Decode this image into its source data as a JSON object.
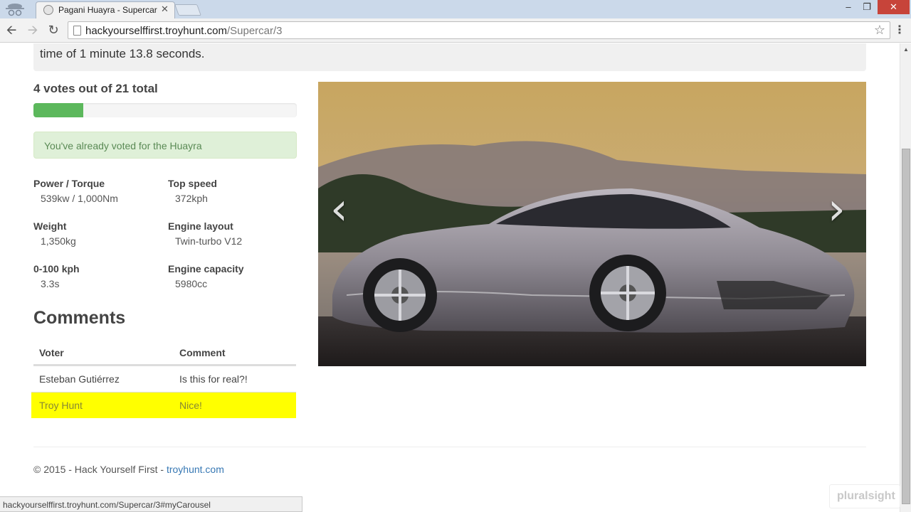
{
  "browser": {
    "tab_title": "Pagani Huayra - Supercar",
    "tab_close": "✕",
    "url_host": "hackyourselffirst.troyhunt.com",
    "url_path": "/Supercar/3",
    "status_url": "hackyourselffirst.troyhunt.com/Supercar/3#myCarousel"
  },
  "page": {
    "description_tail": "time of 1 minute 13.8 seconds.",
    "votes_heading": "4 votes out of 21 total",
    "votes_progress": 0.19,
    "alert": "You've already voted for the Huayra",
    "specs": [
      {
        "label": "Power / Torque",
        "value": "539kw / 1,000Nm"
      },
      {
        "label": "Top speed",
        "value": "372kph"
      },
      {
        "label": "Weight",
        "value": "1,350kg"
      },
      {
        "label": "Engine layout",
        "value": "Twin-turbo V12"
      },
      {
        "label": "0-100 kph",
        "value": "3.3s"
      },
      {
        "label": "Engine capacity",
        "value": "5980cc"
      }
    ],
    "comments_heading": "Comments",
    "comments_columns": [
      "Voter",
      "Comment"
    ],
    "comments": [
      {
        "voter": "Esteban Gutiérrez",
        "comment": "Is this for real?!"
      },
      {
        "voter": "Troy Hunt",
        "comment": "Nice!"
      }
    ],
    "carousel_prev": "‹",
    "carousel_next": "›",
    "footer_text": "© 2015 - Hack Yourself First - ",
    "footer_link": "troyhunt.com"
  },
  "watermark": "pluralsight",
  "colors": {
    "progress": "#5cb85c",
    "alert_bg": "#dff0d8",
    "highlight": "#ffff00",
    "link": "#3778b4"
  }
}
